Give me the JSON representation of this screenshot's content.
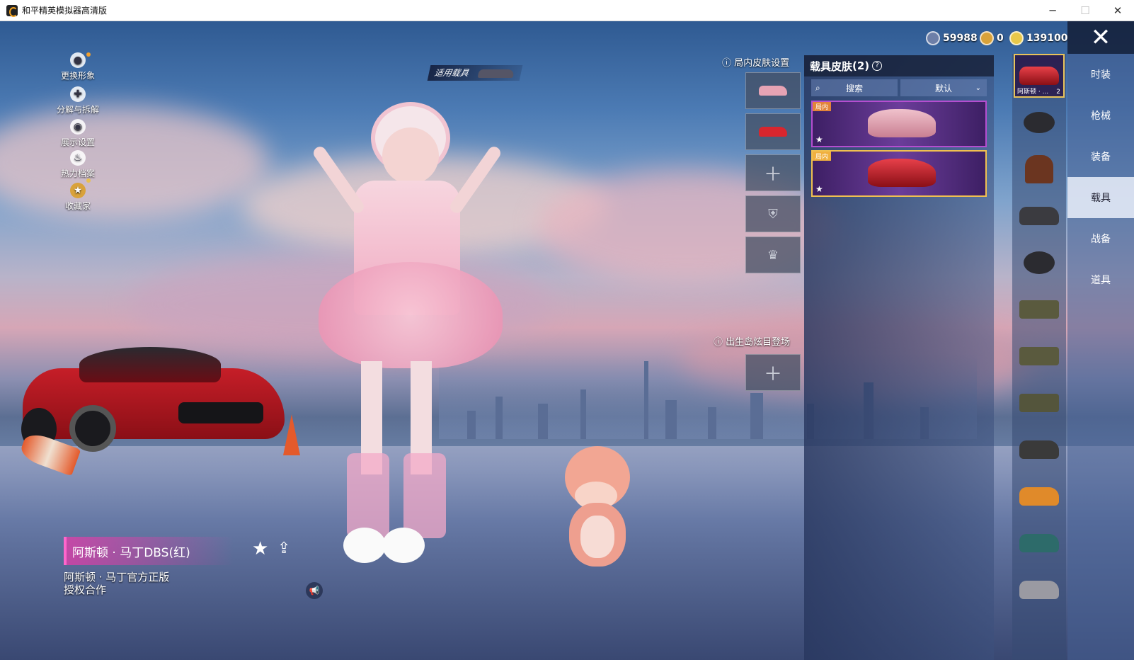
{
  "window": {
    "title": "和平精英模拟器高清版",
    "minimize": "─",
    "maximize": "☐",
    "close": "✕"
  },
  "currency": [
    {
      "value": "59988",
      "color": "#6d7fa8"
    },
    {
      "value": "0",
      "color": "#d9a23a"
    },
    {
      "value": "139100",
      "color": "#e8c84a"
    }
  ],
  "left_menu": [
    {
      "label": "更换形象",
      "icon": "person-icon"
    },
    {
      "label": "分解与拆解",
      "icon": "puzzle-icon"
    },
    {
      "label": "展示设置",
      "icon": "eye-icon"
    },
    {
      "label": "热力档案",
      "icon": "flame-icon"
    },
    {
      "label": "收藏家",
      "icon": "collector-badge-icon"
    }
  ],
  "applicable_vehicle_label": "适用载具",
  "ingame_skin_settings": "局内皮肤设置",
  "spawn_island_label": "出生岛炫目登场",
  "skin_panel": {
    "title": "载具皮肤",
    "count": "(2)",
    "search": "搜索",
    "sort": "默认",
    "cards": [
      {
        "tag": "局内",
        "color": "#e6a3b4"
      },
      {
        "tag": "局内",
        "color": "#d8262e"
      }
    ]
  },
  "categories": [
    "时装",
    "枪械",
    "装备",
    "载具",
    "战备",
    "道具"
  ],
  "active_category": "载具",
  "vehicle_list": {
    "selected_label": "阿斯顿 · ...",
    "selected_count": "2",
    "items": [
      "sports-car",
      "motorcycle",
      "horse",
      "atv",
      "dirt-bike",
      "jeep",
      "jeep",
      "jeep",
      "monster-truck",
      "muscle-car",
      "coupe",
      "sedan"
    ]
  },
  "vehicle_name": "阿斯顿 · 马丁DBS(红)",
  "vehicle_desc": [
    "阿斯顿 · 马丁官方正版",
    "授权合作"
  ]
}
